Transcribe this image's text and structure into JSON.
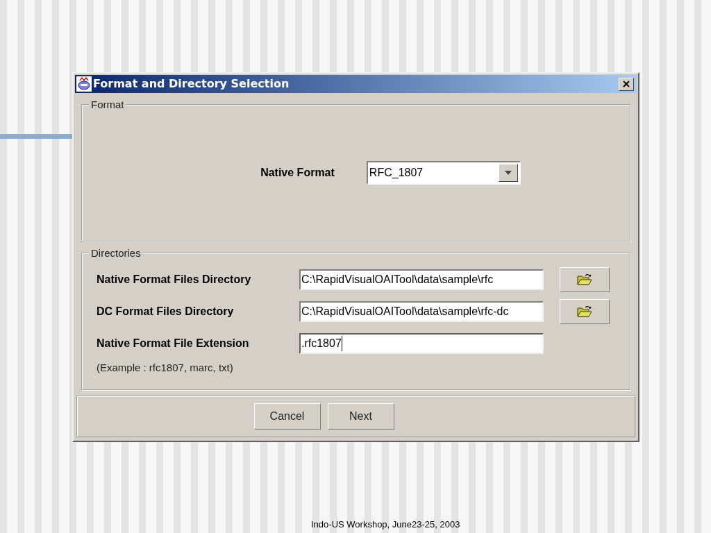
{
  "window": {
    "title": "Format and Directory Selection"
  },
  "format_group": {
    "title": "Format",
    "label": "Native Format",
    "combo_value": "RFC_1807"
  },
  "directories_group": {
    "title": "Directories",
    "fields": [
      {
        "kind": "browse",
        "label": "Native Format Files Directory",
        "value": "C:\\RapidVisualOAITool\\data\\sample\\rfc",
        "focused": false
      },
      {
        "kind": "browse",
        "label": "DC Format Files Directory",
        "value": "C:\\RapidVisualOAITool\\data\\sample\\rfc-dc",
        "focused": false
      },
      {
        "kind": "text",
        "label": "Native Format File Extension",
        "value": ".rfc1807",
        "focused": true
      }
    ],
    "hint": "(Example : rfc1807, marc, txt)"
  },
  "buttons": [
    "Cancel",
    "Next"
  ],
  "slide": {
    "footer": "Indo-US Workshop, June23-25, 2003"
  }
}
